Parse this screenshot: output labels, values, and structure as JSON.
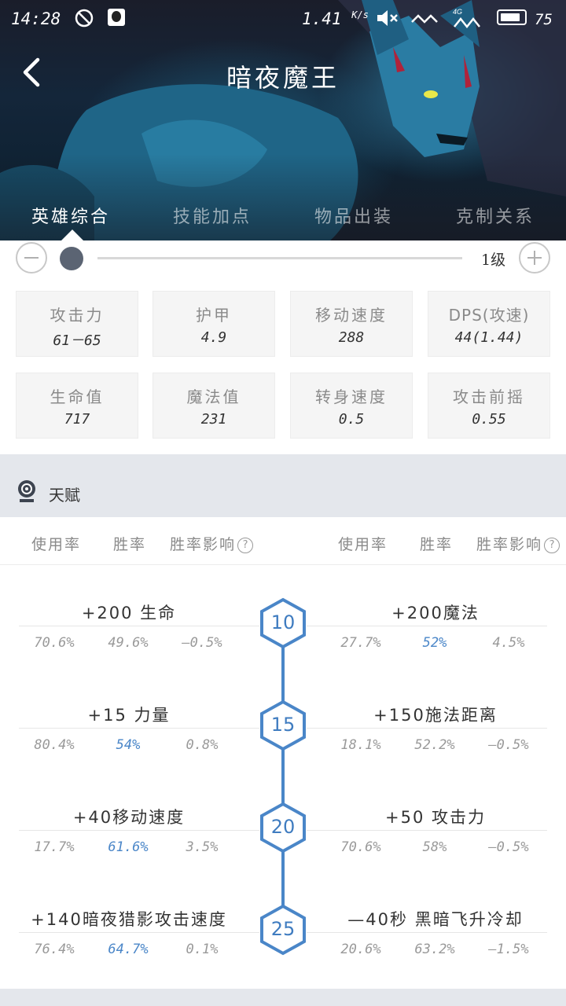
{
  "status_bar": {
    "time": "14:28",
    "speed": "1.41",
    "speed_unit": "K/s",
    "battery": "75"
  },
  "header": {
    "title": "暗夜魔王"
  },
  "tabs": [
    {
      "label": "英雄综合"
    },
    {
      "label": "技能加点"
    },
    {
      "label": "物品出装"
    },
    {
      "label": "克制关系"
    }
  ],
  "level": {
    "label": "1级"
  },
  "stats": [
    {
      "label": "攻击力",
      "value": "61－65"
    },
    {
      "label": "护甲",
      "value": "4.9"
    },
    {
      "label": "移动速度",
      "value": "288"
    },
    {
      "label": "DPS(攻速)",
      "value": "44(1.44)"
    },
    {
      "label": "生命值",
      "value": "717"
    },
    {
      "label": "魔法值",
      "value": "231"
    },
    {
      "label": "转身速度",
      "value": "0.5"
    },
    {
      "label": "攻击前摇",
      "value": "0.55"
    }
  ],
  "talent": {
    "title": "天赋",
    "columns": [
      "使用率",
      "胜率",
      "胜率影响"
    ],
    "help_glyph": "?",
    "tiers": [
      {
        "level": "10",
        "left": {
          "name": "+200 生命",
          "use": "70.6%",
          "win": "49.6%",
          "impact": "—0.5%"
        },
        "right": {
          "name": "+200魔法",
          "use": "27.7%",
          "win": "52%",
          "impact": "4.5%"
        }
      },
      {
        "level": "15",
        "left": {
          "name": "+15 力量",
          "use": "80.4%",
          "win": "54%",
          "impact": "0.8%"
        },
        "right": {
          "name": "+150施法距离",
          "use": "18.1%",
          "win": "52.2%",
          "impact": "—0.5%"
        }
      },
      {
        "level": "20",
        "left": {
          "name": "+40移动速度",
          "use": "17.7%",
          "win": "61.6%",
          "impact": "3.5%"
        },
        "right": {
          "name": "+50 攻击力",
          "use": "70.6%",
          "win": "58%",
          "impact": "—0.5%"
        }
      },
      {
        "level": "25",
        "left": {
          "name": "+140暗夜猎影攻击速度",
          "use": "76.4%",
          "win": "64.7%",
          "impact": "0.1%"
        },
        "right": {
          "name": "—40秒 黑暗飞升冷却",
          "use": "20.6%",
          "win": "63.2%",
          "impact": "—1.5%"
        }
      }
    ]
  },
  "colors": {
    "accent": "#4a86c8",
    "muted": "#999999",
    "panel": "#f5f5f5",
    "divider": "#e4e7ec"
  }
}
